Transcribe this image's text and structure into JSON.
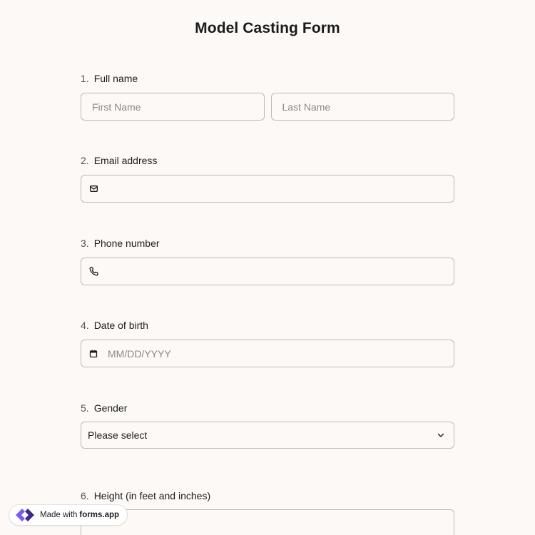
{
  "form": {
    "title": "Model Casting Form",
    "questions": [
      {
        "number": "1.",
        "label": "Full name",
        "first_placeholder": "First Name",
        "last_placeholder": "Last Name"
      },
      {
        "number": "2.",
        "label": "Email address",
        "icon": "mail-icon"
      },
      {
        "number": "3.",
        "label": "Phone number",
        "icon": "phone-icon"
      },
      {
        "number": "4.",
        "label": "Date of birth",
        "icon": "calendar-icon",
        "placeholder": "MM/DD/YYYY"
      },
      {
        "number": "5.",
        "label": "Gender",
        "selected": "Please select",
        "icon": "chevron-down-icon"
      },
      {
        "number": "6.",
        "label": "Height (in feet and inches)"
      }
    ]
  },
  "badge": {
    "prefix": "Made with",
    "brand": "forms.app",
    "brand_colors": [
      "#7c5cf0",
      "#3b2a8a"
    ]
  },
  "colors": {
    "background": "#fcf9f6",
    "border": "#bdbab6",
    "text": "#1d1d1d"
  }
}
